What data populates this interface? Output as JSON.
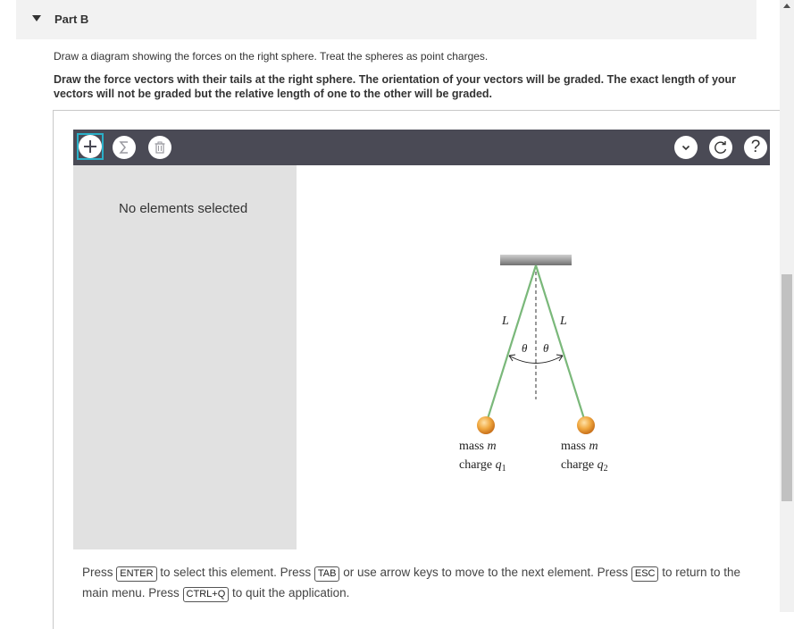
{
  "part": {
    "title": "Part B"
  },
  "instructions": {
    "line1": "Draw a diagram showing the forces on the right sphere. Treat the spheres as point charges.",
    "line2": "Draw the force vectors with their tails at the right sphere. The orientation of your vectors will be graded. The exact length of your vectors will not be graded but the relative length of one to the other will be graded."
  },
  "toolbar": {
    "tools": [
      "add-icon",
      "sigma-icon",
      "trash-icon"
    ],
    "right": [
      "chevron-down-icon",
      "reset-icon",
      "help-icon"
    ],
    "help_label": "?"
  },
  "panel": {
    "no_selection": "No elements selected"
  },
  "diagram": {
    "label_L_left": "L",
    "label_L_right": "L",
    "theta_left": "θ",
    "theta_right": "θ",
    "mass_left": "mass m",
    "mass_right": "mass m",
    "charge_left_prefix": "charge ",
    "charge_left_var": "q",
    "charge_left_sub": "1",
    "charge_right_prefix": "charge ",
    "charge_right_var": "q",
    "charge_right_sub": "2"
  },
  "help": {
    "t1": "Press ",
    "k1": "ENTER",
    "t2": " to select this element. Press ",
    "k2": "TAB",
    "t3": " or use arrow keys to move to the next element. Press ",
    "k3": "ESC",
    "t4": " to return to the main menu. Press ",
    "k4": "CTRL+Q",
    "t5": " to quit the application."
  },
  "colors": {
    "toolbar": "#4a4a55",
    "accent": "#2ab0c8",
    "string": "#7ab87a",
    "sphere": "#e8962b"
  }
}
